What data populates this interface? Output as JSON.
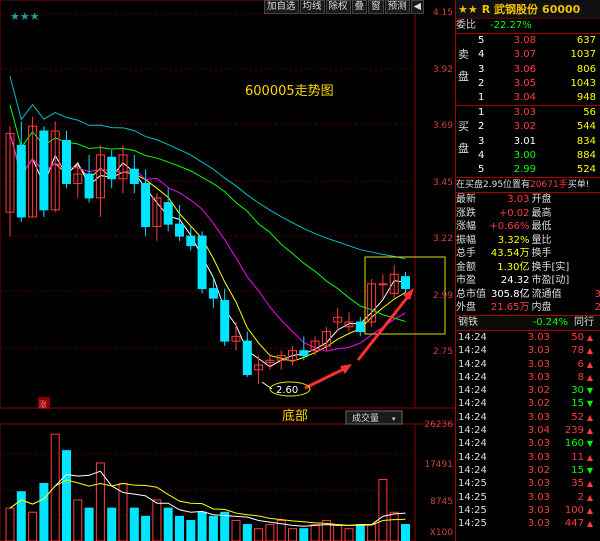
{
  "toolbar": {
    "stars": "★★★",
    "buttons": [
      "加自选",
      "均线",
      "除权",
      "叠",
      "窗",
      "预测"
    ],
    "menu_arrow": "◀"
  },
  "main_chart": {
    "title": "600005走势图",
    "y_ticks": [
      "4.15",
      "3.92",
      "3.69",
      "3.45",
      "3.22",
      "2.99",
      "2.75"
    ],
    "low_label": "2.60",
    "bottom_text": "底部",
    "volume_button": "成交量",
    "up_flag": "涨",
    "vol_ticks": [
      "26236",
      "17491",
      "8745",
      "X100"
    ],
    "colors": {
      "up": "#00e5ff",
      "down": "#ff3b3b",
      "ma1": "#ffffff",
      "ma2": "#ffff00",
      "ma3": "#ff00ff",
      "ma4": "#00ff00",
      "ma5": "#00c0c0"
    }
  },
  "chart_data": {
    "type": "candlestick",
    "ylim": [
      2.5,
      4.15
    ],
    "candles": [
      {
        "o": 3.32,
        "h": 3.68,
        "l": 3.22,
        "c": 3.65
      },
      {
        "o": 3.6,
        "h": 3.7,
        "l": 3.28,
        "c": 3.3
      },
      {
        "o": 3.3,
        "h": 3.72,
        "l": 3.3,
        "c": 3.68
      },
      {
        "o": 3.66,
        "h": 3.68,
        "l": 3.3,
        "c": 3.33
      },
      {
        "o": 3.33,
        "h": 3.7,
        "l": 3.32,
        "c": 3.66
      },
      {
        "o": 3.62,
        "h": 3.66,
        "l": 3.42,
        "c": 3.44
      },
      {
        "o": 3.44,
        "h": 3.52,
        "l": 3.38,
        "c": 3.48
      },
      {
        "o": 3.48,
        "h": 3.56,
        "l": 3.36,
        "c": 3.38
      },
      {
        "o": 3.38,
        "h": 3.6,
        "l": 3.3,
        "c": 3.56
      },
      {
        "o": 3.55,
        "h": 3.58,
        "l": 3.42,
        "c": 3.46
      },
      {
        "o": 3.46,
        "h": 3.6,
        "l": 3.4,
        "c": 3.56
      },
      {
        "o": 3.5,
        "h": 3.56,
        "l": 3.4,
        "c": 3.44
      },
      {
        "o": 3.44,
        "h": 3.5,
        "l": 3.22,
        "c": 3.26
      },
      {
        "o": 3.26,
        "h": 3.4,
        "l": 3.2,
        "c": 3.38
      },
      {
        "o": 3.36,
        "h": 3.42,
        "l": 3.24,
        "c": 3.27
      },
      {
        "o": 3.27,
        "h": 3.35,
        "l": 3.2,
        "c": 3.22
      },
      {
        "o": 3.22,
        "h": 3.26,
        "l": 3.16,
        "c": 3.18
      },
      {
        "o": 3.22,
        "h": 3.24,
        "l": 2.98,
        "c": 3.0
      },
      {
        "o": 3.0,
        "h": 3.05,
        "l": 2.92,
        "c": 2.96
      },
      {
        "o": 2.95,
        "h": 3.0,
        "l": 2.76,
        "c": 2.78
      },
      {
        "o": 2.78,
        "h": 2.86,
        "l": 2.74,
        "c": 2.8
      },
      {
        "o": 2.78,
        "h": 2.82,
        "l": 2.63,
        "c": 2.64
      },
      {
        "o": 2.66,
        "h": 2.72,
        "l": 2.6,
        "c": 2.68
      },
      {
        "o": 2.69,
        "h": 2.72,
        "l": 2.66,
        "c": 2.7
      },
      {
        "o": 2.7,
        "h": 2.74,
        "l": 2.66,
        "c": 2.72
      },
      {
        "o": 2.7,
        "h": 2.76,
        "l": 2.68,
        "c": 2.74
      },
      {
        "o": 2.74,
        "h": 2.8,
        "l": 2.7,
        "c": 2.72
      },
      {
        "o": 2.74,
        "h": 2.8,
        "l": 2.72,
        "c": 2.78
      },
      {
        "o": 2.76,
        "h": 2.84,
        "l": 2.74,
        "c": 2.82
      },
      {
        "o": 2.86,
        "h": 2.92,
        "l": 2.82,
        "c": 2.88
      },
      {
        "o": 2.84,
        "h": 2.9,
        "l": 2.82,
        "c": 2.86
      },
      {
        "o": 2.86,
        "h": 2.88,
        "l": 2.8,
        "c": 2.82
      },
      {
        "o": 2.86,
        "h": 3.04,
        "l": 2.84,
        "c": 3.02
      },
      {
        "o": 3.02,
        "h": 3.06,
        "l": 2.96,
        "c": 3.02
      },
      {
        "o": 2.98,
        "h": 3.1,
        "l": 2.96,
        "c": 3.06
      },
      {
        "o": 3.05,
        "h": 3.07,
        "l": 2.98,
        "c": 3.0
      }
    ],
    "volume": [
      8,
      12,
      7,
      14,
      26,
      22,
      10,
      8,
      19,
      8,
      14,
      8,
      6,
      10,
      8,
      6,
      5,
      7,
      6,
      7,
      5,
      4,
      3,
      4,
      5,
      3,
      3,
      4,
      5,
      4,
      3,
      4,
      4,
      15,
      7,
      4
    ]
  },
  "quote": {
    "stars": "★★",
    "name": "R 武钢股份",
    "code": "60000",
    "weibi_label": "委比",
    "weibi_value": "-22.27%",
    "sell_label": "卖盘",
    "buy_label": "买盘",
    "sells": [
      {
        "n": "5",
        "price": "3.08",
        "vol": "637"
      },
      {
        "n": "4",
        "price": "3.07",
        "vol": "1037"
      },
      {
        "n": "3",
        "price": "3.06",
        "vol": "806"
      },
      {
        "n": "2",
        "price": "3.05",
        "vol": "1043"
      },
      {
        "n": "1",
        "price": "3.04",
        "vol": "948"
      }
    ],
    "buys": [
      {
        "n": "1",
        "price": "3.03",
        "vol": "56"
      },
      {
        "n": "2",
        "price": "3.02",
        "vol": "544"
      },
      {
        "n": "3",
        "price": "3.01",
        "vol": "834"
      },
      {
        "n": "4",
        "price": "3.00",
        "vol": "884"
      },
      {
        "n": "5",
        "price": "2.99",
        "vol": "524"
      }
    ],
    "marquee": "在买盘2.95位置有",
    "marquee_vol": "20671手",
    "marquee_tail": "买单!",
    "stats": [
      {
        "l": "最新",
        "v": "3.03",
        "l2": "开盘",
        "v2": ""
      },
      {
        "l": "涨跌",
        "v": "+0.02",
        "l2": "最高",
        "v2": ""
      },
      {
        "l": "涨幅",
        "v": "+0.66%",
        "l2": "最低",
        "v2": ""
      },
      {
        "l": "振幅",
        "v": "3.32%",
        "l2": "量比",
        "v2": ""
      },
      {
        "l": "总手",
        "v": "43.54万",
        "l2": "换手",
        "v2": ""
      },
      {
        "l": "金额",
        "v": "1.30亿",
        "l2": "换手[实]",
        "v2": ""
      },
      {
        "l": "市盈",
        "v": "24.32",
        "l2": "市盈[动]",
        "v2": ""
      },
      {
        "l": "总市值",
        "v": "305.8亿",
        "l2": "流通值",
        "v2": "3"
      },
      {
        "l": "外盘",
        "v": "21.65万",
        "l2": "内盘",
        "v2": "2"
      }
    ],
    "sector_name": "钢铁",
    "sector_change": "-0.24%",
    "sector_more": "同行",
    "ticks": [
      {
        "t": "14:24",
        "p": "3.03",
        "v": "50",
        "dir": "up"
      },
      {
        "t": "14:24",
        "p": "3.03",
        "v": "78",
        "dir": "up"
      },
      {
        "t": "14:24",
        "p": "3.03",
        "v": "6",
        "dir": "up"
      },
      {
        "t": "14:24",
        "p": "3.03",
        "v": "8",
        "dir": "up"
      },
      {
        "t": "14:24",
        "p": "3.02",
        "v": "30",
        "dir": "down"
      },
      {
        "t": "14:24",
        "p": "3.02",
        "v": "15",
        "dir": "down"
      },
      {
        "t": "14:24",
        "p": "3.03",
        "v": "52",
        "dir": "up"
      },
      {
        "t": "14:24",
        "p": "3.04",
        "v": "239",
        "dir": "up"
      },
      {
        "t": "14:24",
        "p": "3.03",
        "v": "160",
        "dir": "down"
      },
      {
        "t": "14:24",
        "p": "3.03",
        "v": "11",
        "dir": "up"
      },
      {
        "t": "14:24",
        "p": "3.02",
        "v": "15",
        "dir": "down"
      },
      {
        "t": "14:25",
        "p": "3.03",
        "v": "35",
        "dir": "up"
      },
      {
        "t": "14:25",
        "p": "3.03",
        "v": "2",
        "dir": "up"
      },
      {
        "t": "14:25",
        "p": "3.03",
        "v": "100",
        "dir": "up"
      },
      {
        "t": "14:25",
        "p": "3.03",
        "v": "447",
        "dir": "up"
      }
    ]
  }
}
